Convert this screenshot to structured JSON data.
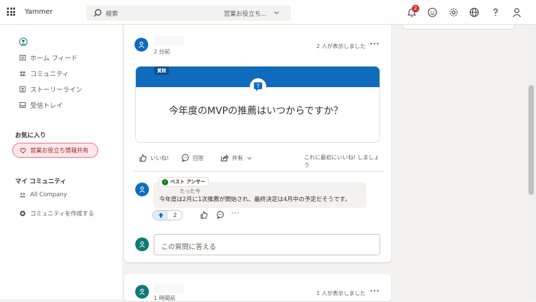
{
  "app": {
    "name": "Yammer",
    "notification_count": "2"
  },
  "search": {
    "placeholder": "検索",
    "scope": "営業お役立ち..."
  },
  "nav": {
    "items": [
      {
        "label": "ホーム フィード"
      },
      {
        "label": "コミュニティ"
      },
      {
        "label": "ストーリーライン"
      },
      {
        "label": "受信トレイ"
      }
    ],
    "favorites_heading": "お気に入り",
    "favorite_community": "営業お役立ち情報共有",
    "my_communities_heading": "マイ コミュニティ",
    "all_company": "All Company",
    "create_community": "コミュニティを作成する"
  },
  "post": {
    "time": "2 分前",
    "seen_by": "2 人が表示しました",
    "question_label": "質問",
    "question_text": "今年度のMVPの推薦はいつからですか？",
    "actions": {
      "like": "いいね!",
      "reply": "回答",
      "share": "共有",
      "like_prompt": "これに最初にいいね! しましょう"
    }
  },
  "reply": {
    "best_answer_label": "ベスト アンサー",
    "time": "たった今",
    "text": "今年度は2月に1次推薦が開始され、最終決定は4月中の予定だそうです。",
    "upvotes": "2"
  },
  "answer_input": {
    "placeholder": "この質問に答える"
  },
  "post2": {
    "time": "1 時間前",
    "seen_by": "1 人が表示しました"
  },
  "colors": {
    "brand_blue": "#0f6cbd",
    "teal": "#0e7b73",
    "favorite_text": "#a4262c",
    "badge": "#d13438"
  }
}
